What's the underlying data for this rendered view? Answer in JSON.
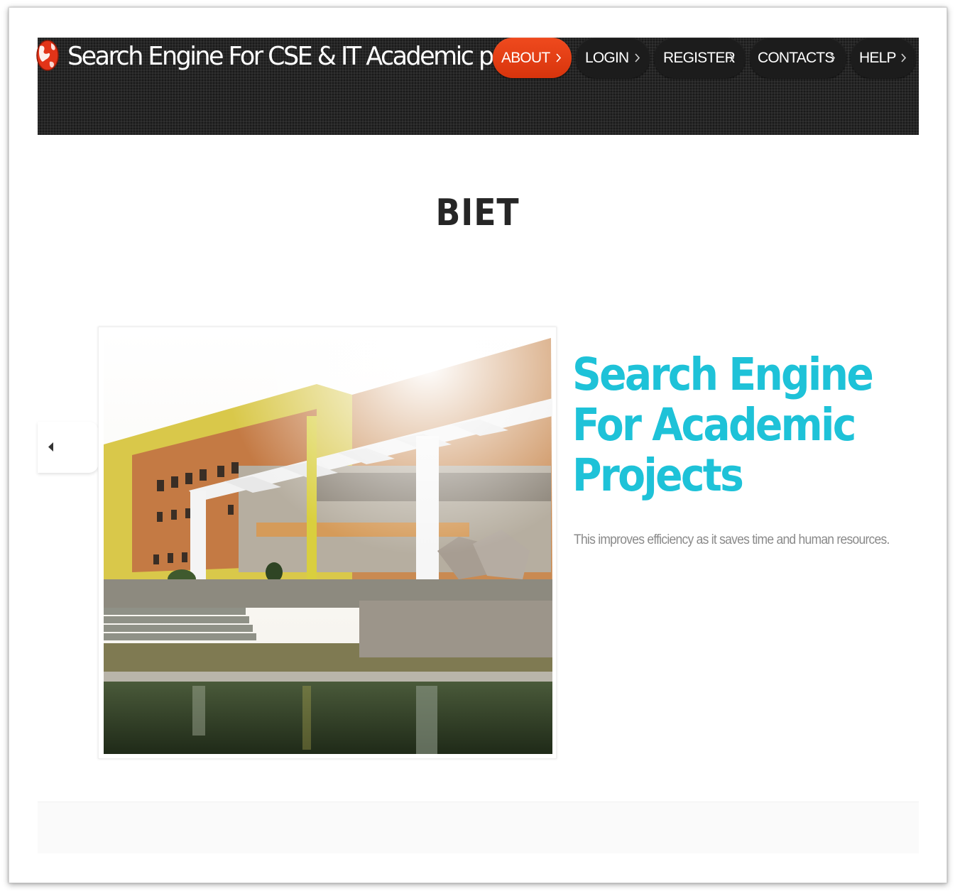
{
  "header": {
    "site_title": "Search Engine For CSE & IT Academic projects",
    "logo_icon": "globe-icon",
    "nav": [
      {
        "label": "ABOUT",
        "active": true
      },
      {
        "label": "LOGIN",
        "active": false
      },
      {
        "label": "REGISTER",
        "active": false
      },
      {
        "label": "CONTACTS",
        "active": false
      },
      {
        "label": "HELP",
        "active": false
      }
    ],
    "active_color": "#e8421a",
    "bar_color": "#262626"
  },
  "main": {
    "heading": "BIET",
    "slider": {
      "prev_icon": "triangle-left-icon",
      "image_icon": "college-building-photo",
      "title_lines": [
        "Search Engine",
        "For Academic",
        "Projects"
      ],
      "title_color": "#1ec2d8",
      "description": "This improves efficiency as it saves time and human resources."
    }
  }
}
